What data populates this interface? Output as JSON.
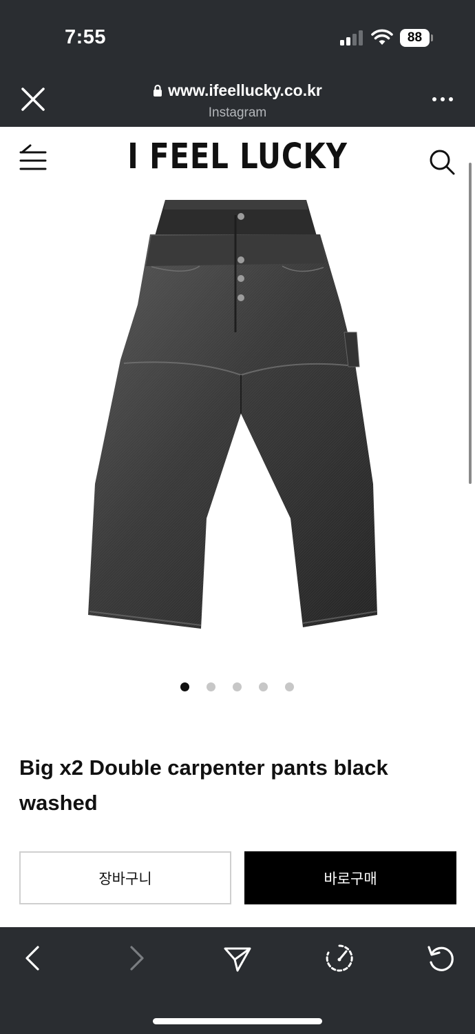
{
  "status_bar": {
    "time": "7:55",
    "battery": "88"
  },
  "browser": {
    "url": "www.ifeellucky.co.kr",
    "source": "Instagram"
  },
  "site": {
    "logo": "I FEEL LUCKY"
  },
  "carousel": {
    "total": 5,
    "active_index": 0
  },
  "product": {
    "title": "Big x2 Double carpenter pants black washed",
    "cart_label": "장바구니",
    "buy_label": "바로구매"
  },
  "icons": {
    "close": "close-icon",
    "lock": "lock-icon",
    "more": "more-icon",
    "menu": "menu-icon",
    "search": "search-icon",
    "back": "back-icon",
    "forward": "forward-icon",
    "share": "send-icon",
    "speed": "speed-icon",
    "reload": "reload-icon"
  },
  "colors": {
    "chrome": "#2a2d31",
    "buy_button": "#000000"
  }
}
